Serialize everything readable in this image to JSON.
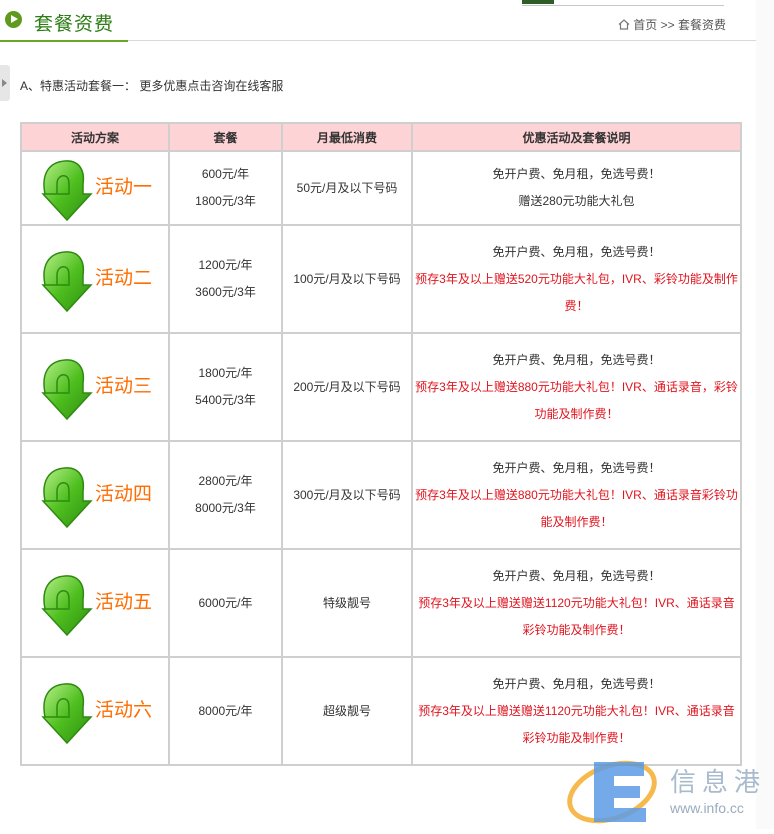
{
  "header": {
    "title": "套餐资费",
    "breadcrumb": {
      "home": "首页",
      "separator": ">>",
      "current": "套餐资费"
    }
  },
  "intro_text": "A、特惠活动套餐一： 更多优惠点击咨询在线客服",
  "table": {
    "columns": [
      "活动方案",
      "套餐",
      "月最低消费",
      "优惠活动及套餐说明"
    ],
    "rows": [
      {
        "plan": "活动一",
        "prices": [
          "600元/年",
          "1800元/3年"
        ],
        "min_monthly": "50元/月及以下号码",
        "desc_lines": [
          "免开户费、免月租，免选号费！",
          "赠送280元功能大礼包"
        ],
        "desc_red": ""
      },
      {
        "plan": "活动二",
        "prices": [
          "1200元/年",
          "3600元/3年"
        ],
        "min_monthly": "100元/月及以下号码",
        "desc_lines": [
          "免开户费、免月租，免选号费！"
        ],
        "desc_red": "预存3年及以上赠送520元功能大礼包，IVR、彩铃功能及制作费！"
      },
      {
        "plan": "活动三",
        "prices": [
          "1800元/年",
          "5400元/3年"
        ],
        "min_monthly": "200元/月及以下号码",
        "desc_lines": [
          "免开户费、免月租，免选号费！"
        ],
        "desc_red": "预存3年及以上赠送880元功能大礼包！IVR、通话录音，彩铃功能及制作费！"
      },
      {
        "plan": "活动四",
        "prices": [
          "2800元/年",
          "8000元/3年"
        ],
        "min_monthly": "300元/月及以下号码",
        "desc_lines": [
          "免开户费、免月租，免选号费！"
        ],
        "desc_red": "预存3年及以上赠送880元功能大礼包！IVR、通话录音彩铃功能及制作费！"
      },
      {
        "plan": "活动五",
        "prices": [
          "6000元/年"
        ],
        "min_monthly": "特级靓号",
        "desc_lines": [
          "免开户费、免月租，免选号费！"
        ],
        "desc_red": "预存3年及以上赠送赠送1120元功能大礼包！IVR、通话录音彩铃功能及制作费！"
      },
      {
        "plan": "活动六",
        "prices": [
          "8000元/年"
        ],
        "min_monthly": "超级靓号",
        "desc_lines": [
          "免开户费、免月租，免选号费！"
        ],
        "desc_red": "预存3年及以上赠送赠送1120元功能大礼包！IVR、通话录音彩铃功能及制作费！"
      }
    ]
  },
  "watermark": {
    "text": "信息港",
    "url": "www.info.cc"
  },
  "colors": {
    "title_green": "#2d7d16",
    "header_pink": "#fdd3d6",
    "plan_orange": "#ff6c00",
    "promo_red": "#e0141e",
    "arrow_green": "#4fbf1f"
  },
  "icons": {
    "title": "play-bullet-icon",
    "home": "home-icon",
    "plan": "green-down-arrow-icon"
  }
}
